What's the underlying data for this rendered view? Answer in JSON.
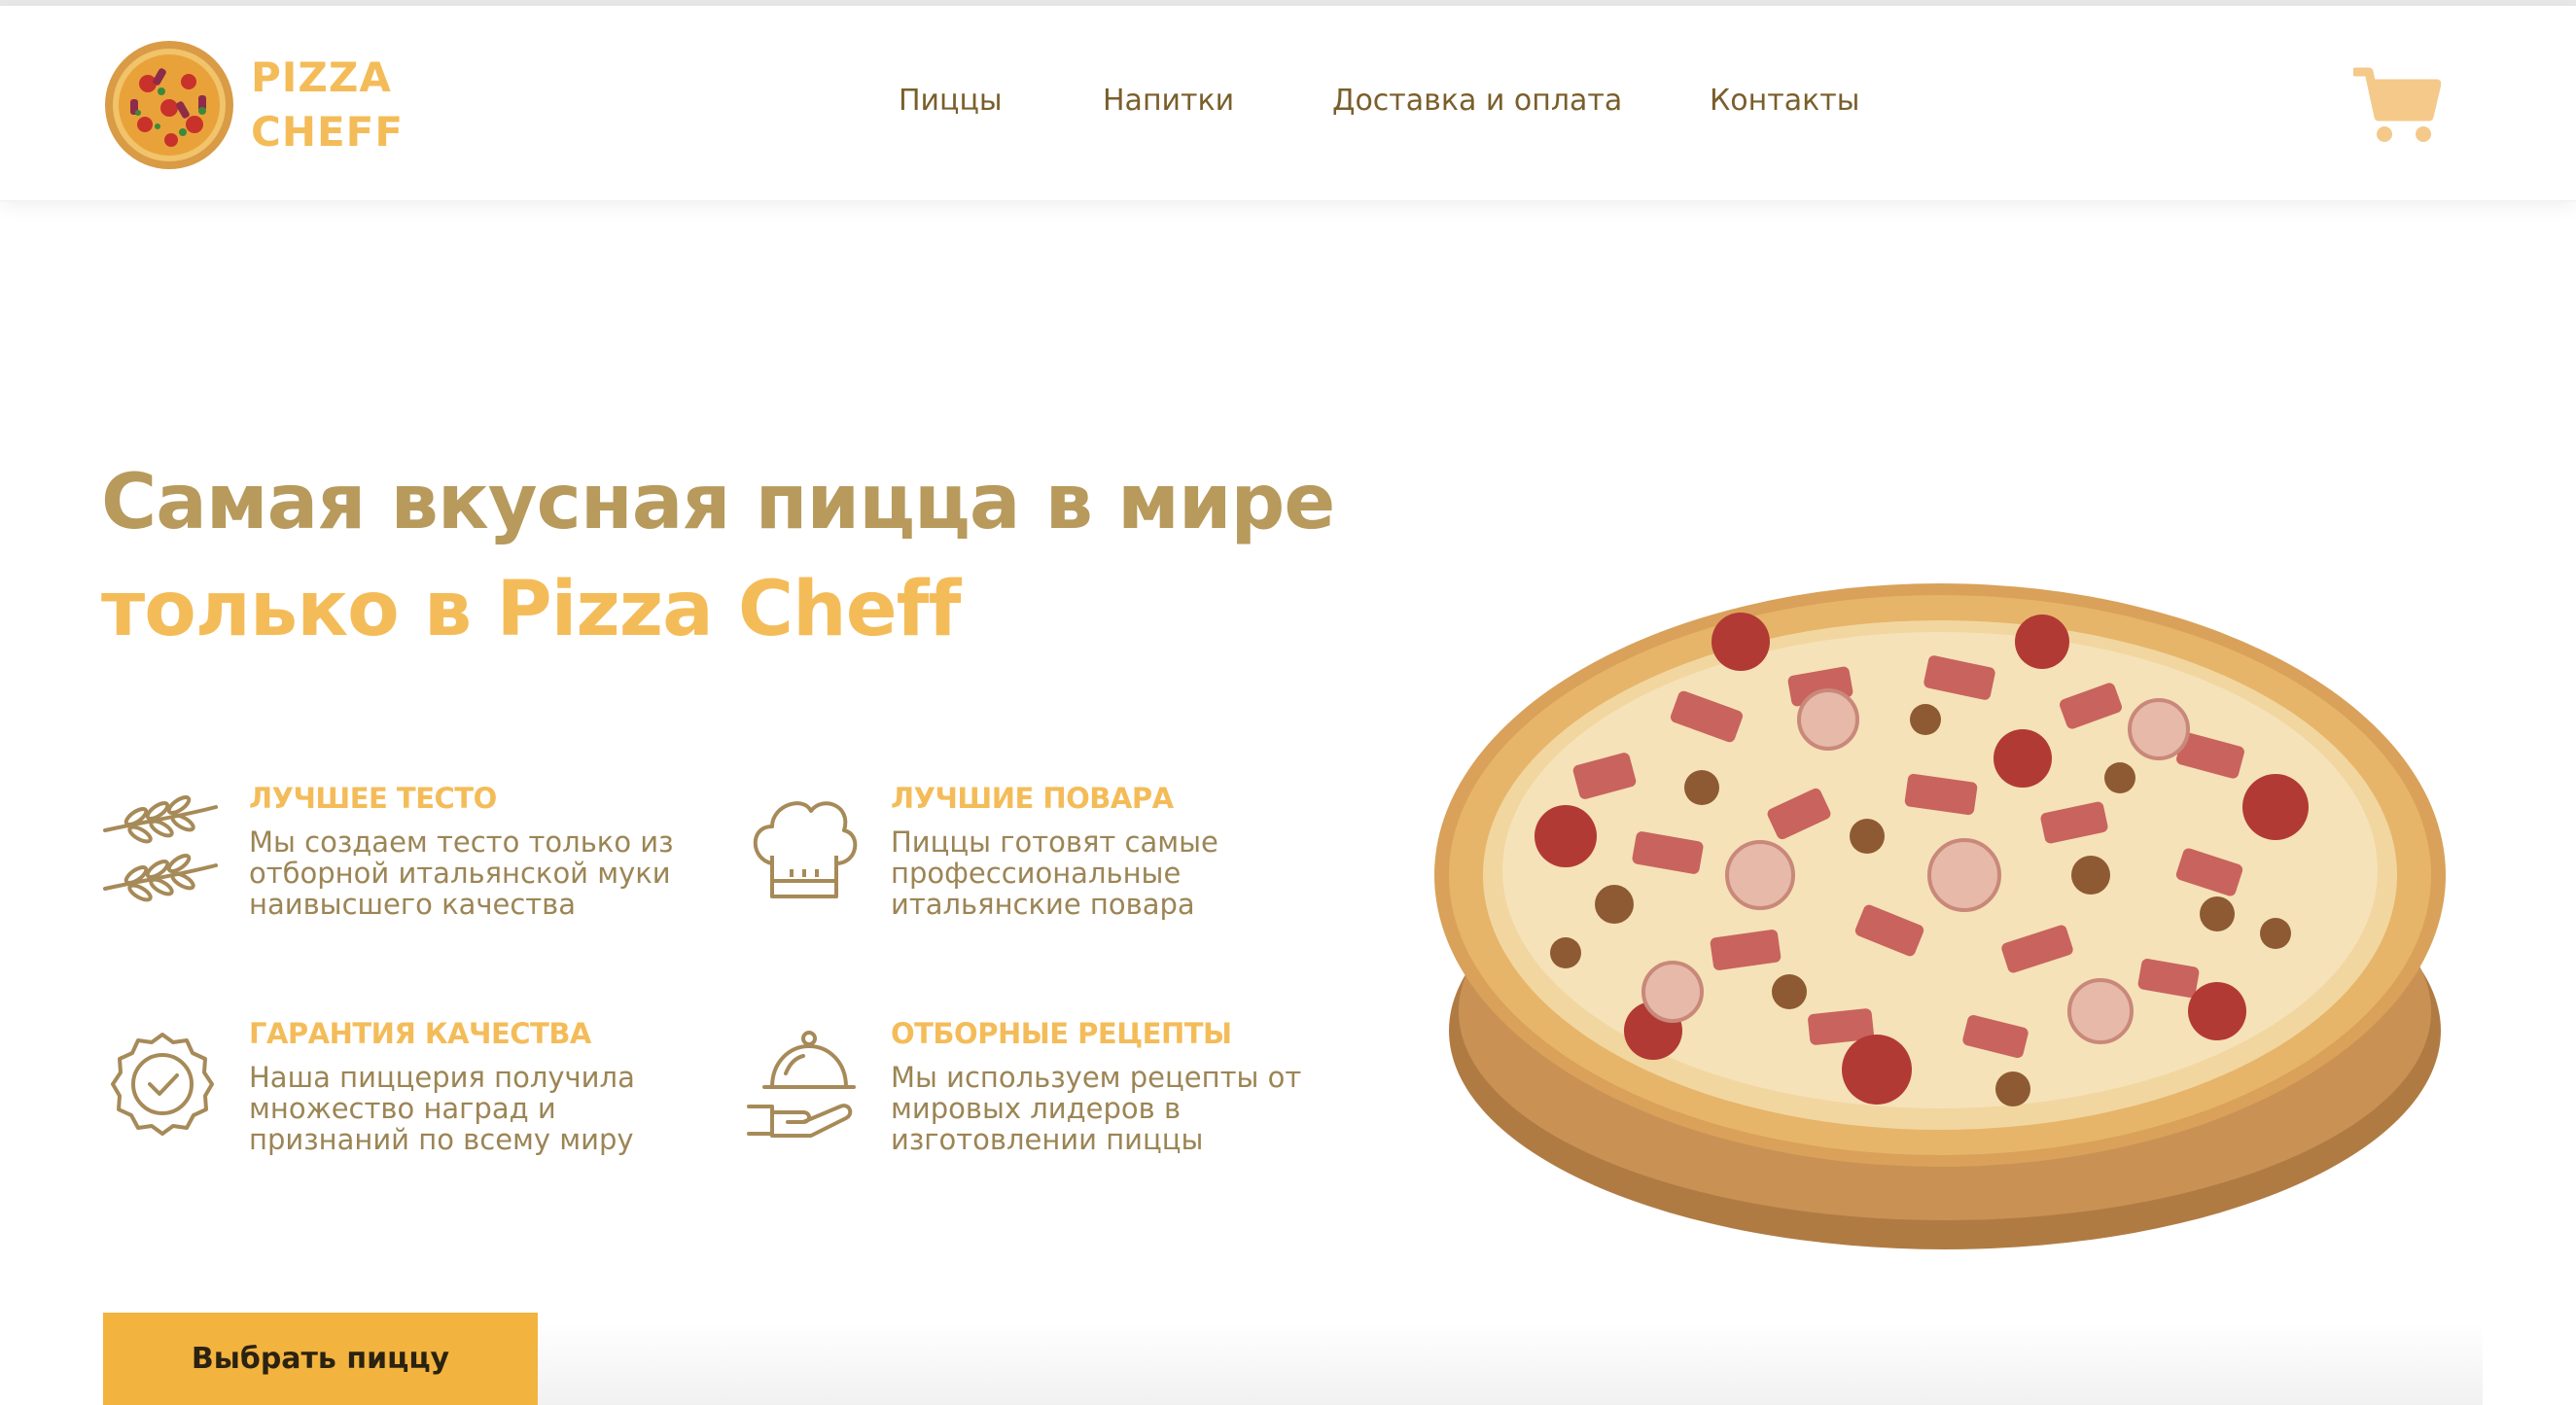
{
  "brand": {
    "line1": "PIZZA",
    "line2": "CHEFF"
  },
  "nav": {
    "items": [
      {
        "label": "Пиццы"
      },
      {
        "label": "Напитки"
      },
      {
        "label": "Доставка и оплата"
      },
      {
        "label": "Контакты"
      }
    ]
  },
  "hero": {
    "title_line1": "Самая вкусная пицца в мире",
    "title_line2": "только в Pizza Cheff",
    "cta_label": "Выбрать пиццу"
  },
  "features": [
    {
      "icon": "wheat-icon",
      "title": "ЛУЧШЕЕ ТЕСТО",
      "text": "Мы создаем тесто только из отборной итальянской муки наивысшего качества"
    },
    {
      "icon": "chef-hat-icon",
      "title": "ЛУЧШИЕ ПОВАРА",
      "text": "Пиццы готовят самые профессиональные итальянские повара"
    },
    {
      "icon": "quality-badge-icon",
      "title": "ГАРАНТИЯ КАЧЕСТВА",
      "text": "Наша пиццерия получила множество наград и признаний по всему миру"
    },
    {
      "icon": "cloche-icon",
      "title": "ОТБОРНЫЕ РЕЦЕПТЫ",
      "text": "Мы используем рецепты от мировых лидеров в изготовлении пиццы"
    }
  ],
  "colors": {
    "accent": "#f4bc59",
    "accent_dark": "#b79a5c",
    "nav_text": "#7a5e2b",
    "body_text": "#9c8555",
    "button": "#f2b33f",
    "icon_stroke": "#a68a58"
  }
}
